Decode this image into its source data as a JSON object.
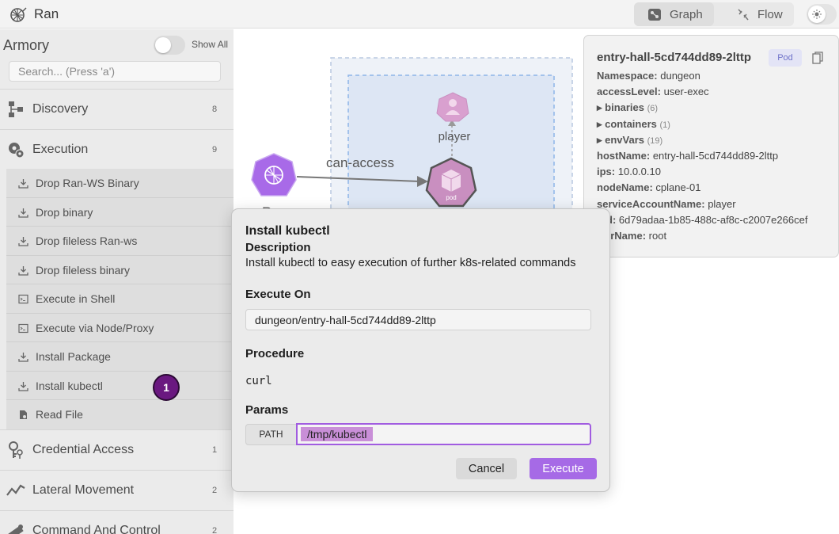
{
  "app": {
    "title": "Ran"
  },
  "view_tabs": [
    {
      "label": "Graph",
      "icon": "graph-icon",
      "active": true
    },
    {
      "label": "Flow",
      "icon": "flow-icon",
      "active": false
    }
  ],
  "sidebar": {
    "title": "Armory",
    "show_all_label": "Show All",
    "search_placeholder": "Search... (Press 'a')",
    "categories": [
      {
        "label": "Discovery",
        "count": "8",
        "icon": "discovery-icon"
      },
      {
        "label": "Execution",
        "count": "9",
        "icon": "execution-gear-icon"
      },
      {
        "label": "Credential Access",
        "count": "1",
        "icon": "credential-access-icon"
      },
      {
        "label": "Lateral Movement",
        "count": "2",
        "icon": "lateral-movement-icon"
      },
      {
        "label": "Command And Control",
        "count": "2",
        "icon": "command-control-icon"
      }
    ],
    "execution_items": [
      {
        "label": "Drop Ran-WS Binary",
        "icon": "download-icon"
      },
      {
        "label": "Drop binary",
        "icon": "download-icon"
      },
      {
        "label": "Drop fileless Ran-ws",
        "icon": "download-icon"
      },
      {
        "label": "Drop fileless binary",
        "icon": "download-icon"
      },
      {
        "label": "Execute in Shell",
        "icon": "terminal-icon"
      },
      {
        "label": "Execute via Node/Proxy",
        "icon": "terminal-icon"
      },
      {
        "label": "Install Package",
        "icon": "download-icon"
      },
      {
        "label": "Install kubectl",
        "icon": "download-icon"
      },
      {
        "label": "Read File",
        "icon": "file-icon"
      }
    ],
    "step_badge": "1"
  },
  "graph": {
    "edge_label": "can-access",
    "node_player_label": "player",
    "node_pod_label": "pod",
    "node_ran_partial_label": "R"
  },
  "info_panel": {
    "title": "entry-hall-5cd744dd89-2lttp",
    "badge": "Pod",
    "rows": [
      {
        "key": "Namespace:",
        "value": "dungeon"
      },
      {
        "key": "accessLevel:",
        "value": "user-exec"
      },
      {
        "key": "▸ binaries",
        "count": "(6)"
      },
      {
        "key": "▸ containers",
        "count": "(1)"
      },
      {
        "key": "▸ envVars",
        "count": "(19)"
      },
      {
        "key": "hostName:",
        "value": "entry-hall-5cd744dd89-2lttp"
      },
      {
        "key": "ips:",
        "value": "10.0.0.10"
      },
      {
        "key": "nodeName:",
        "value": "cplane-01"
      },
      {
        "key": "serviceAccountName:",
        "value": "player"
      },
      {
        "key": "d:",
        "value": "6d79adaa-1b85-488c-af8c-c2007e266cef"
      },
      {
        "key": "erName:",
        "value": "root"
      }
    ]
  },
  "modal": {
    "title": "Install kubectl",
    "description_heading": "Description",
    "description": "Install kubectl to easy execution of further k8s-related commands",
    "execute_on_heading": "Execute On",
    "execute_on_value": "dungeon/entry-hall-5cd744dd89-2lttp",
    "procedure_heading": "Procedure",
    "procedure_value": "curl",
    "params_heading": "Params",
    "param_key": "PATH",
    "param_value": "/tmp/kubectl",
    "cancel_label": "Cancel",
    "execute_label": "Execute"
  },
  "colors": {
    "accent": "#a66ae6",
    "node_purple": "#a86ae8",
    "node_pink": "#c98fc0",
    "step_badge": "#6a1880",
    "graph_group_bg": "#dde6f4",
    "graph_group_border": "#9ec0ea"
  }
}
